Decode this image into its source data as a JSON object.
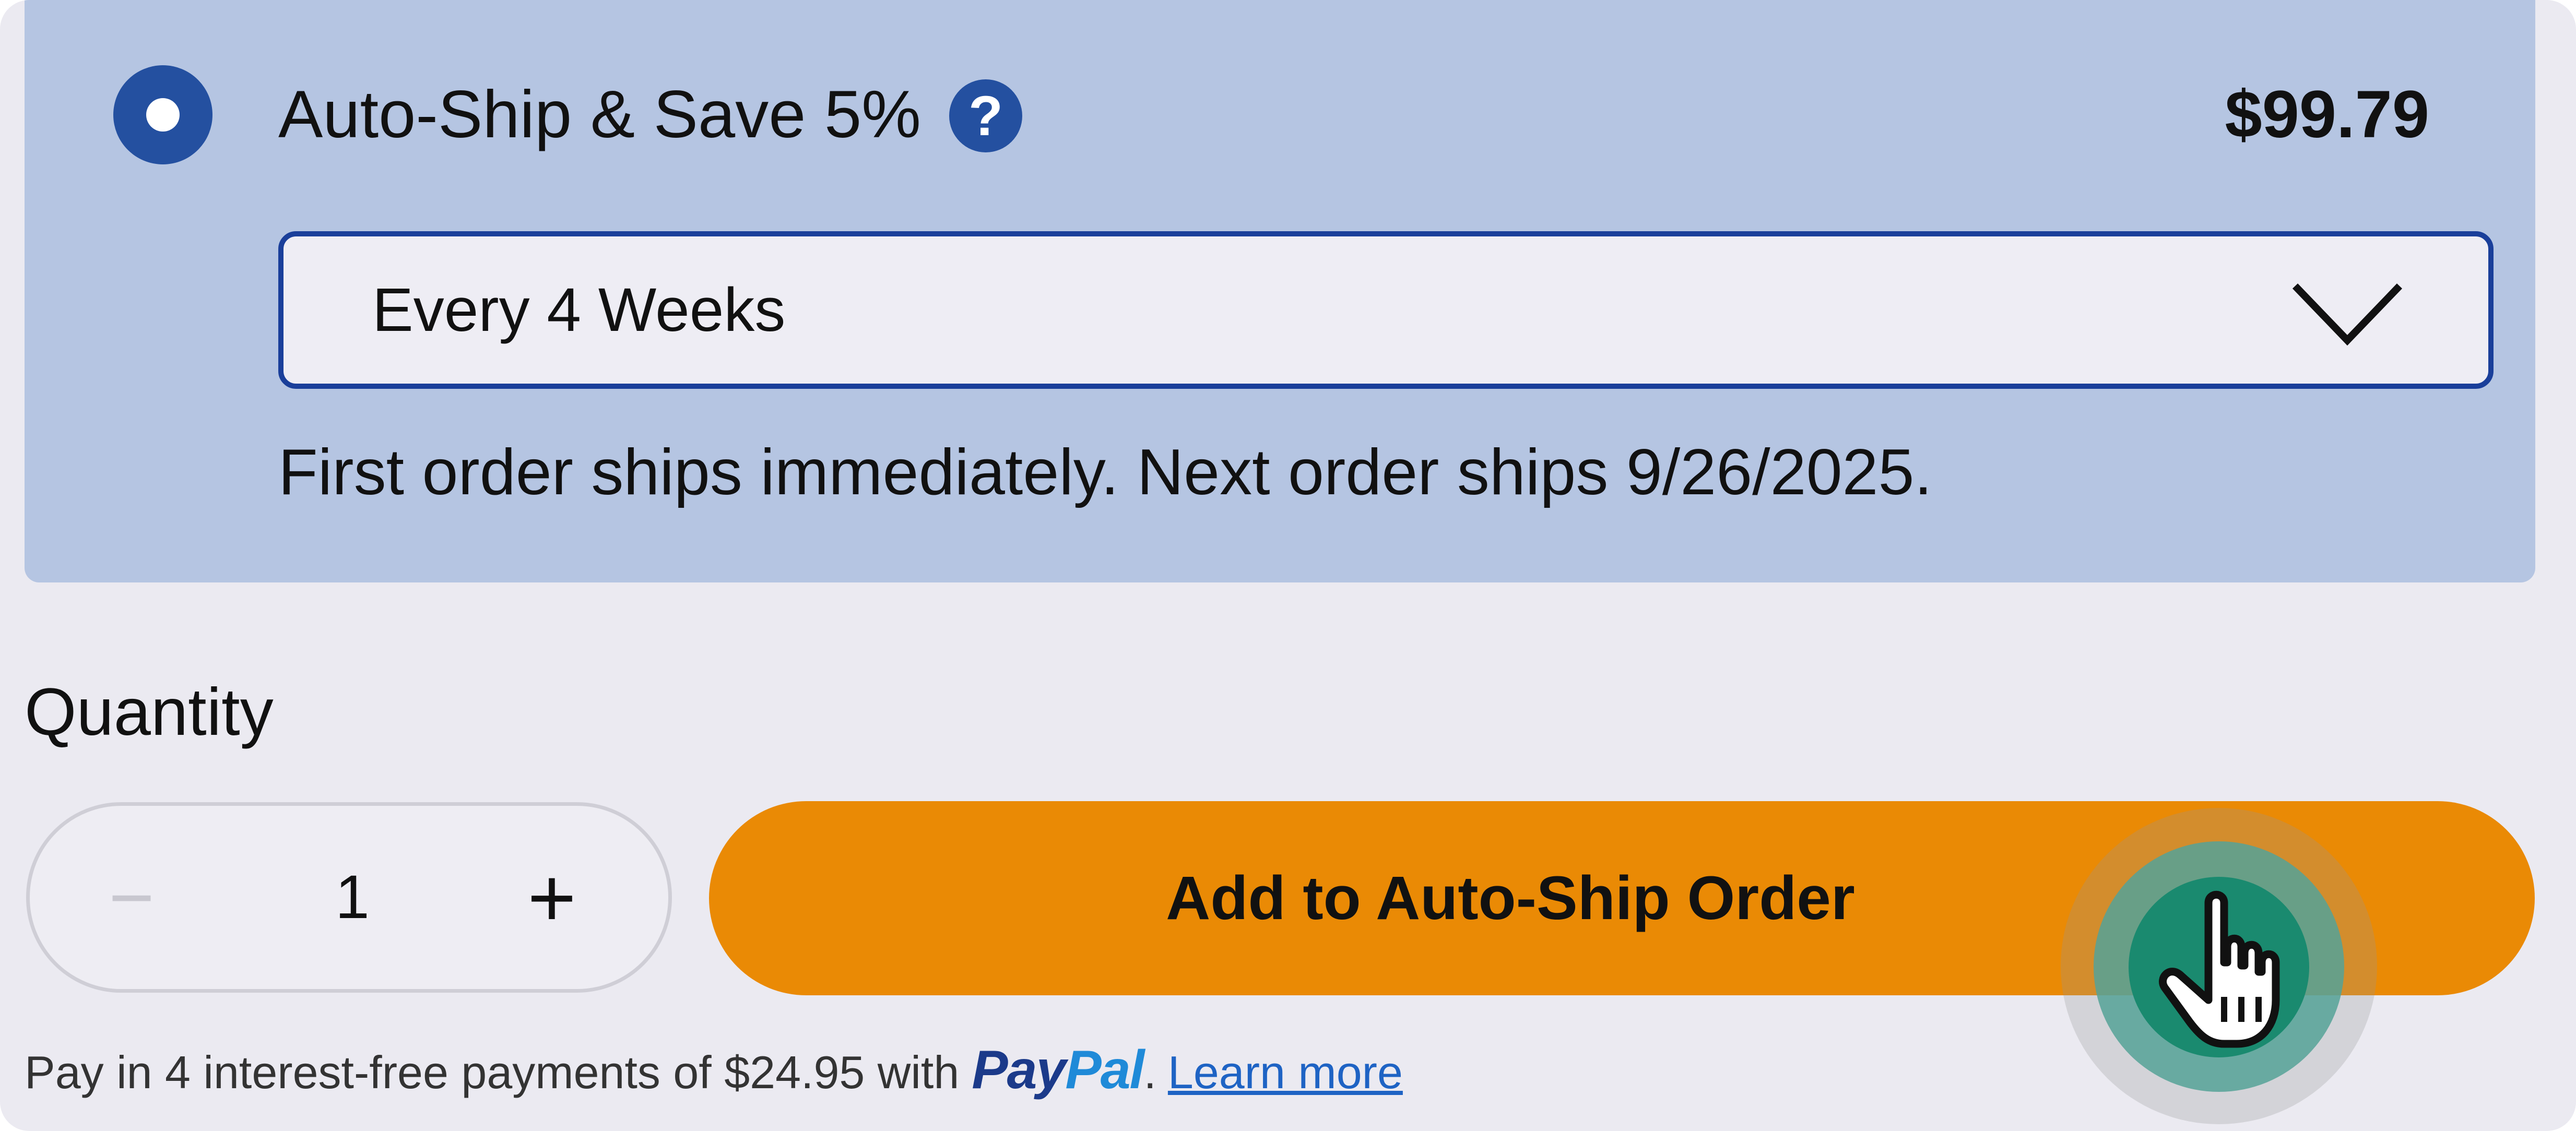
{
  "autoship": {
    "option_label": "Auto-Ship & Save 5%",
    "help_symbol": "?",
    "price": "$99.79",
    "selected": true,
    "frequency": {
      "selected_value": "Every 4 Weeks"
    },
    "note": "First order ships immediately. Next order ships 9/26/2025."
  },
  "quantity": {
    "label": "Quantity",
    "decrement_symbol": "−",
    "value": "1",
    "increment_symbol": "+"
  },
  "add_button": {
    "label": "Add to Auto-Ship Order"
  },
  "payment": {
    "text": "Pay in 4 interest-free payments of $24.95 with",
    "logo_pay": "Pay",
    "logo_pal": "Pal",
    "dot": ".",
    "learn_more": "Learn more"
  },
  "colors": {
    "panel_bg": "#b5c5e2",
    "accent_blue": "#2450a0",
    "button_orange": "#ea8a05",
    "link_blue": "#1e63c4"
  },
  "icons": [
    "radio-selected-icon",
    "help-icon",
    "chevron-down-icon",
    "hand-cursor-icon"
  ]
}
